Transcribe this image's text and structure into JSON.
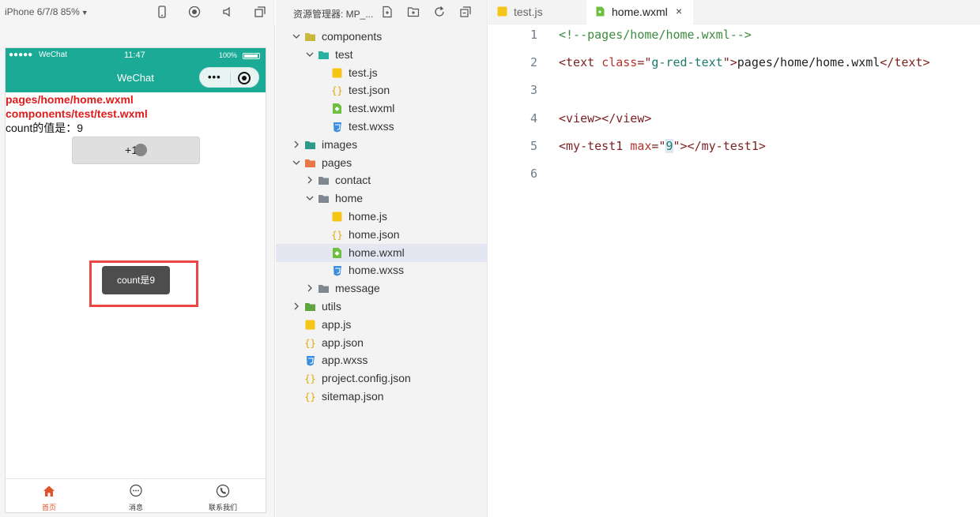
{
  "simulator": {
    "device_label": "iPhone 6/7/8 85%",
    "status_bar": {
      "carrier": "WeChat",
      "time": "11:47",
      "battery": "100%"
    },
    "nav_title": "WeChat",
    "page_lines": {
      "line1": "pages/home/home.wxml",
      "line2": "components/test/test.wxml",
      "line3": "count的值是：9"
    },
    "plus_button_label": "+1",
    "toast_text": "count是9",
    "tabs": [
      {
        "label": "首页",
        "icon": "home-icon",
        "active": true
      },
      {
        "label": "消息",
        "icon": "message-icon",
        "active": false
      },
      {
        "label": "联系我们",
        "icon": "phone-icon",
        "active": false
      }
    ],
    "colors": {
      "nav_bg": "#1aaa96",
      "red_text": "#e01b1b",
      "active_tab": "#e0542b",
      "highlight": "#ee4444"
    }
  },
  "explorer": {
    "title": "资源管理器: MP_...",
    "tree": [
      {
        "label": "components",
        "type": "folder",
        "icon": "folder-components-icon",
        "expanded": true,
        "depth": 0
      },
      {
        "label": "test",
        "type": "folder",
        "icon": "folder-test-icon",
        "expanded": true,
        "depth": 1
      },
      {
        "label": "test.js",
        "type": "js",
        "icon": "js-file-icon",
        "depth": 2
      },
      {
        "label": "test.json",
        "type": "json",
        "icon": "json-file-icon",
        "depth": 2
      },
      {
        "label": "test.wxml",
        "type": "wxml",
        "icon": "wxml-file-icon",
        "depth": 2
      },
      {
        "label": "test.wxss",
        "type": "wxss",
        "icon": "wxss-file-icon",
        "depth": 2
      },
      {
        "label": "images",
        "type": "folder",
        "icon": "folder-images-icon",
        "expanded": false,
        "depth": 0
      },
      {
        "label": "pages",
        "type": "folder",
        "icon": "folder-pages-icon",
        "expanded": true,
        "depth": 0
      },
      {
        "label": "contact",
        "type": "folder",
        "icon": "folder-icon",
        "expanded": false,
        "depth": 1
      },
      {
        "label": "home",
        "type": "folder",
        "icon": "folder-open-icon",
        "expanded": true,
        "depth": 1
      },
      {
        "label": "home.js",
        "type": "js",
        "icon": "js-file-icon",
        "depth": 2
      },
      {
        "label": "home.json",
        "type": "json",
        "icon": "json-file-icon",
        "depth": 2
      },
      {
        "label": "home.wxml",
        "type": "wxml",
        "icon": "wxml-file-icon",
        "depth": 2,
        "selected": true
      },
      {
        "label": "home.wxss",
        "type": "wxss",
        "icon": "wxss-file-icon",
        "depth": 2
      },
      {
        "label": "message",
        "type": "folder",
        "icon": "folder-icon",
        "expanded": false,
        "depth": 1
      },
      {
        "label": "utils",
        "type": "folder",
        "icon": "folder-utils-icon",
        "expanded": false,
        "depth": 0
      },
      {
        "label": "app.js",
        "type": "js",
        "icon": "js-file-icon",
        "depth": 0,
        "leaf_root": true
      },
      {
        "label": "app.json",
        "type": "json",
        "icon": "json-file-icon",
        "depth": 0,
        "leaf_root": true
      },
      {
        "label": "app.wxss",
        "type": "wxss",
        "icon": "wxss-file-icon",
        "depth": 0,
        "leaf_root": true
      },
      {
        "label": "project.config.json",
        "type": "json",
        "icon": "json-file-icon",
        "depth": 0,
        "leaf_root": true
      },
      {
        "label": "sitemap.json",
        "type": "json",
        "icon": "json-file-icon",
        "depth": 0,
        "leaf_root": true
      }
    ]
  },
  "editor": {
    "tabs": [
      {
        "label": "test.js",
        "icon": "js-file-icon",
        "active": false
      },
      {
        "label": "home.wxml",
        "icon": "wxml-file-icon",
        "active": true,
        "close": "×"
      }
    ],
    "lines": [
      {
        "no": "1",
        "tokens": [
          {
            "t": "<!--pages/home/home.wxml-->",
            "c": "comment"
          }
        ]
      },
      {
        "no": "2",
        "tokens": [
          {
            "t": "<text ",
            "c": "tag"
          },
          {
            "t": "class",
            "c": "attr"
          },
          {
            "t": "=\"",
            "c": "tag"
          },
          {
            "t": "g-red-text",
            "c": "str"
          },
          {
            "t": "\">",
            "c": "tag"
          },
          {
            "t": "pages/home/home.wxml",
            "c": "text"
          },
          {
            "t": "</text>",
            "c": "tag"
          }
        ]
      },
      {
        "no": "3",
        "tokens": []
      },
      {
        "no": "4",
        "tokens": [
          {
            "t": "<view></view>",
            "c": "tag"
          }
        ]
      },
      {
        "no": "5",
        "tokens": [
          {
            "t": "<my-test1 ",
            "c": "tag"
          },
          {
            "t": "max",
            "c": "attr"
          },
          {
            "t": "=\"",
            "c": "tag"
          },
          {
            "t": "9",
            "c": "str-sel"
          },
          {
            "t": "\"></my-test1>",
            "c": "tag"
          }
        ]
      },
      {
        "no": "6",
        "tokens": []
      }
    ]
  }
}
